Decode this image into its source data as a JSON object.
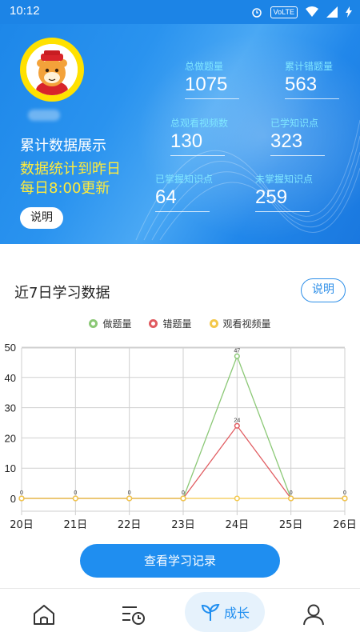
{
  "status_bar": {
    "time": "10:12",
    "volte": "VoLTE"
  },
  "header": {
    "title": "累计数据展示",
    "note_line1": "数据统计到昨日",
    "note_line2": "每日8:00更新",
    "explain_label": "说明",
    "stats": [
      {
        "label": "总做题量",
        "value": "1075"
      },
      {
        "label": "累计错题量",
        "value": "563"
      },
      {
        "label": "总观看视频数",
        "value": "130"
      },
      {
        "label": "已学知识点",
        "value": "323"
      },
      {
        "label": "已掌握知识点",
        "value": "64"
      },
      {
        "label": "未掌握知识点",
        "value": "259"
      }
    ]
  },
  "section": {
    "title": "近7日学习数据",
    "explain_label": "说明"
  },
  "colors": {
    "accent": "#1f8ef0",
    "green": "#8bc876",
    "red": "#e05a5f",
    "yellow": "#f3c84b"
  },
  "chart_data": {
    "type": "line",
    "categories": [
      "20日",
      "21日",
      "22日",
      "23日",
      "24日",
      "25日",
      "26日"
    ],
    "series": [
      {
        "name": "做题量",
        "color": "#8bc876",
        "values": [
          0,
          0,
          0,
          0,
          47,
          0,
          0
        ]
      },
      {
        "name": "错题量",
        "color": "#e05a5f",
        "values": [
          0,
          0,
          0,
          0,
          24,
          0,
          0
        ]
      },
      {
        "name": "观看视频量",
        "color": "#f3c84b",
        "values": [
          0,
          0,
          0,
          0,
          0,
          0,
          0
        ]
      }
    ],
    "yticks": [
      0,
      10,
      20,
      30,
      40,
      50
    ],
    "ylim": [
      -5,
      50
    ],
    "grid": true,
    "legend": "top-center"
  },
  "actions": {
    "record_button": "查看学习记录"
  },
  "tabbar": {
    "active_label": "成长"
  }
}
